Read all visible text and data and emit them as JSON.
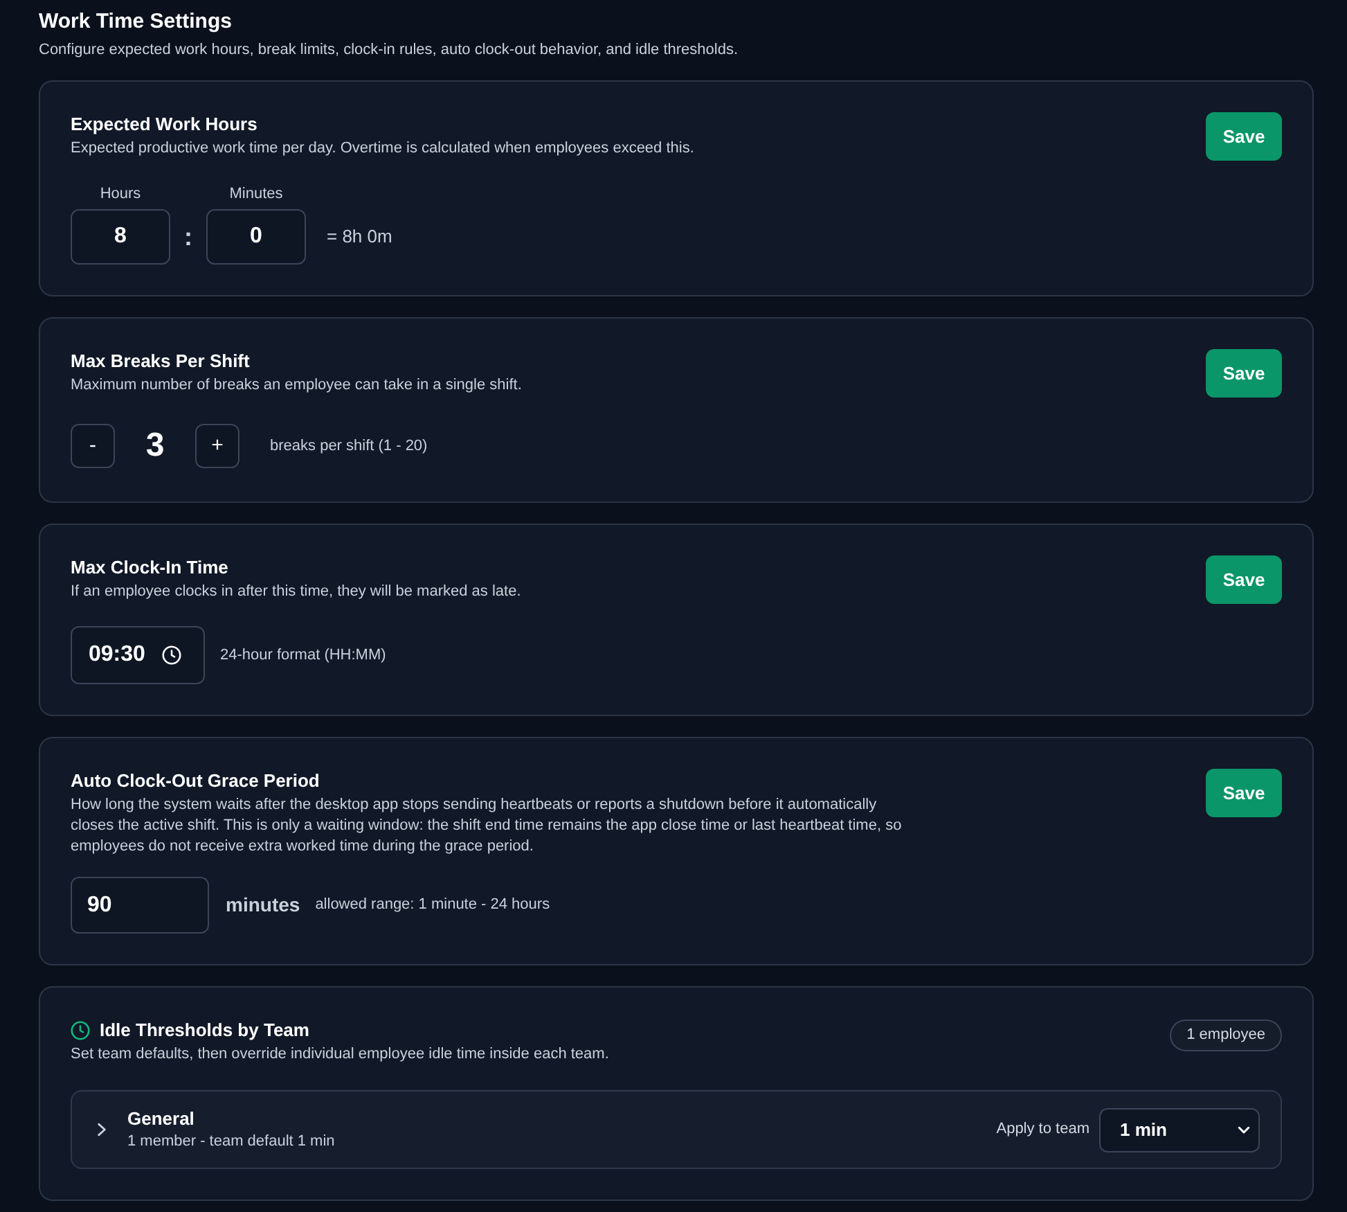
{
  "header": {
    "title": "Work Time Settings",
    "description": "Configure expected work hours, break limits, clock-in rules, auto clock-out behavior, and idle thresholds."
  },
  "cards": [
    {
      "kind": "work_hours",
      "title": "Expected Work Hours",
      "description": "Expected productive work time per day. Overtime is calculated when employees exceed this.",
      "save_label": "Save",
      "fields": [
        {
          "label": "Hours",
          "value": "8"
        },
        {
          "label": "Minutes",
          "value": "0"
        }
      ],
      "separator": ":",
      "summary": "= 8h 0m"
    },
    {
      "kind": "stepper",
      "title": "Max Breaks Per Shift",
      "description": "Maximum number of breaks an employee can take in a single shift.",
      "save_label": "Save",
      "decrement": "-",
      "value": "3",
      "increment": "+",
      "hint": "breaks per shift (1 - 20)"
    },
    {
      "kind": "time",
      "title": "Max Clock-In Time",
      "description": "If an employee clocks in after this time, they will be marked as late.",
      "save_label": "Save",
      "value": "09:30",
      "hint": "24-hour format (HH:MM)"
    },
    {
      "kind": "duration",
      "title": "Auto Clock-Out Grace Period",
      "description": "How long the system waits after the desktop app stops sending heartbeats or reports a shutdown before it automatically closes the active shift. This is only a waiting window: the shift end time remains the app close time or last heartbeat time, so employees do not receive extra worked time during the grace period.",
      "save_label": "Save",
      "value": "90",
      "unit": "minutes",
      "hint": "allowed range: 1 minute - 24 hours"
    },
    {
      "kind": "teams",
      "title": "Idle Thresholds by Team",
      "description": "Set team defaults, then override individual employee idle time inside each team.",
      "badge": "1 employee",
      "teams": [
        {
          "name": "General",
          "summary": "1 member - team default 1 min",
          "expanded": false,
          "apply_label": "Apply to team",
          "select_value": "1 min"
        }
      ]
    }
  ]
}
